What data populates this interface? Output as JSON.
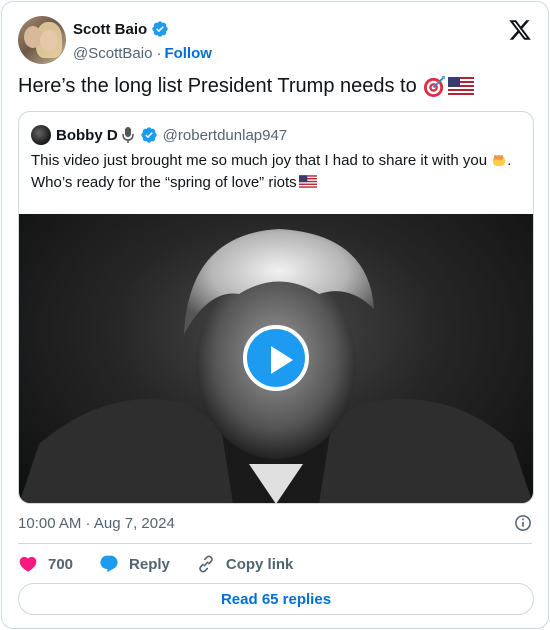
{
  "author": {
    "display_name": "Scott Baio",
    "handle": "@ScottBaio",
    "separator": "·",
    "follow_label": "Follow"
  },
  "tweet": {
    "text": "Here’s the long list President Trump needs to"
  },
  "quote": {
    "display_name": "Bobby D",
    "handle": "@robertdunlap947",
    "text_part1": "This video just brought me so much joy that I had to share it with you",
    "text_part2": ". Who’s ready for the “spring of love” riots"
  },
  "timestamp": "10:00 AM · Aug 7, 2024",
  "actions": {
    "like_count": "700",
    "reply_label": "Reply",
    "copy_link_label": "Copy link"
  },
  "read_replies_label": "Read 65 replies",
  "colors": {
    "link_blue": "#006fd6",
    "verified_blue": "#1d9bf0",
    "like_pink": "#f91880",
    "muted": "#536471",
    "border": "#cfd9de"
  },
  "icons": [
    "verified-badge-icon",
    "x-logo-icon",
    "target-emoji-icon",
    "us-flag-emoji-icon",
    "microphone-icon",
    "fist-emoji-icon",
    "play-icon",
    "info-icon",
    "heart-icon",
    "reply-bubble-icon",
    "link-icon"
  ]
}
